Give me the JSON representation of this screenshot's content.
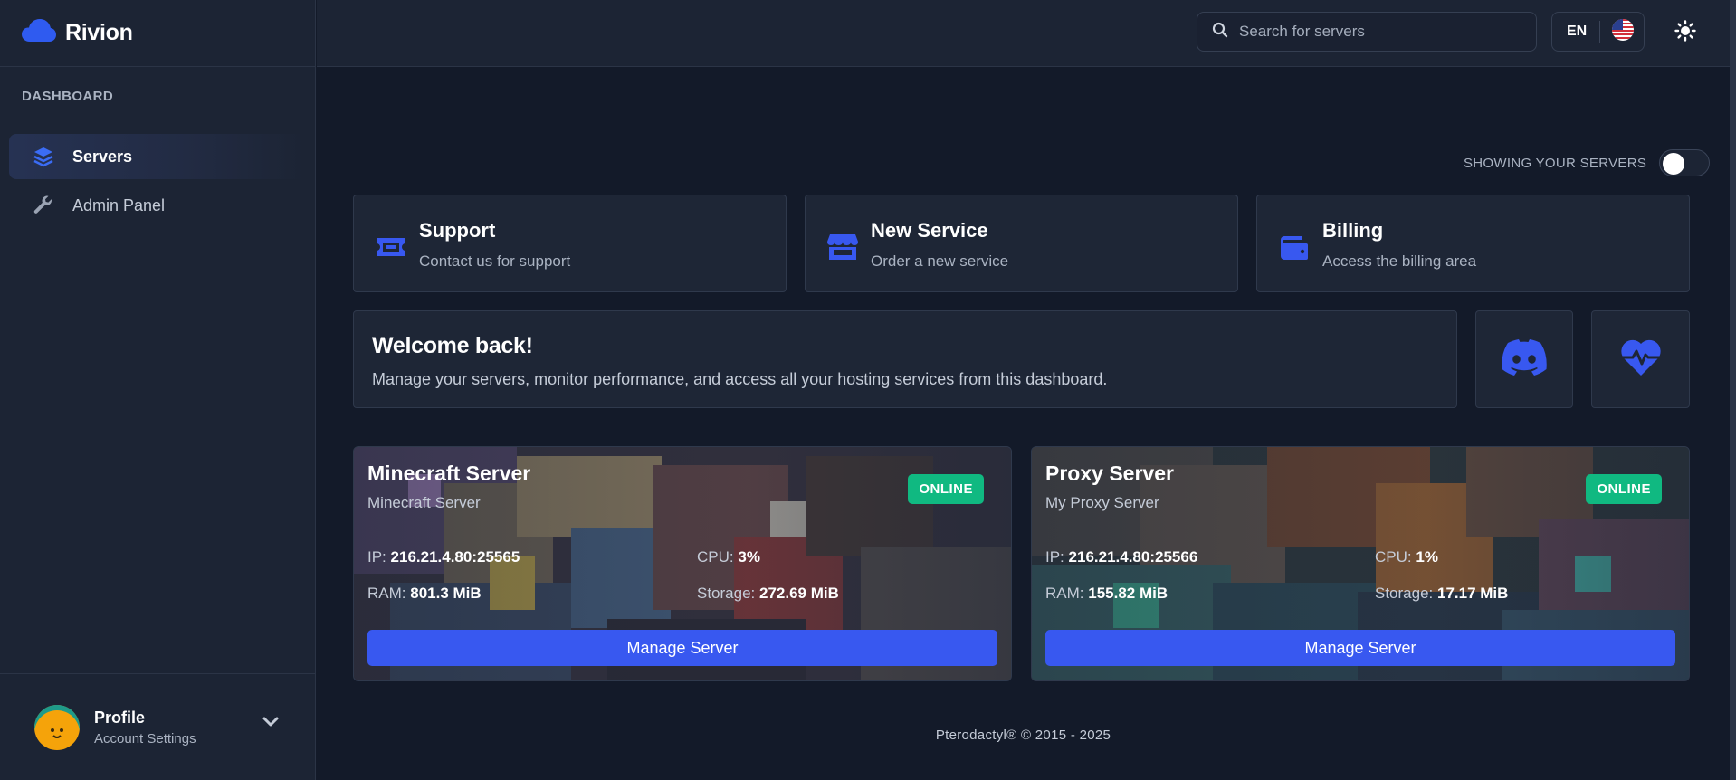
{
  "app": {
    "name": "Rivion"
  },
  "colors": {
    "accent": "#3858f0",
    "online": "#10b981",
    "background": "#131a29",
    "panel": "#1c2434"
  },
  "sidebar": {
    "section_label": "DASHBOARD",
    "items": [
      {
        "label": "Servers",
        "icon": "layers-icon",
        "active": true
      },
      {
        "label": "Admin Panel",
        "icon": "wrench-icon",
        "active": false
      }
    ],
    "profile": {
      "name": "Profile",
      "subtitle": "Account Settings"
    }
  },
  "topbar": {
    "search_placeholder": "Search for servers",
    "language": "EN",
    "theme_icon": "sun-icon"
  },
  "main": {
    "toggle_label": "SHOWING YOUR SERVERS",
    "toggle_on": false,
    "quick_cards": [
      {
        "title": "Support",
        "subtitle": "Contact us for support",
        "icon": "ticket-icon"
      },
      {
        "title": "New Service",
        "subtitle": "Order a new service",
        "icon": "store-icon"
      },
      {
        "title": "Billing",
        "subtitle": "Access the billing area",
        "icon": "wallet-icon"
      }
    ],
    "welcome": {
      "title": "Welcome back!",
      "text": "Manage your servers, monitor performance, and access all your hosting services from this dashboard."
    },
    "servers": [
      {
        "name": "Minecraft Server",
        "description": "Minecraft Server",
        "status": "ONLINE",
        "ip_label": "IP:",
        "ip": "216.21.4.80:25565",
        "cpu_label": "CPU:",
        "cpu": "3%",
        "ram_label": "RAM:",
        "ram": "801.3 MiB",
        "storage_label": "Storage:",
        "storage": "272.69 MiB",
        "button": "Manage Server"
      },
      {
        "name": "Proxy Server",
        "description": "My Proxy Server",
        "status": "ONLINE",
        "ip_label": "IP:",
        "ip": "216.21.4.80:25566",
        "cpu_label": "CPU:",
        "cpu": "1%",
        "ram_label": "RAM:",
        "ram": "155.82 MiB",
        "storage_label": "Storage:",
        "storage": "17.17 MiB",
        "button": "Manage Server"
      }
    ]
  },
  "footer": {
    "text": "Pterodactyl® © 2015 - 2025"
  }
}
